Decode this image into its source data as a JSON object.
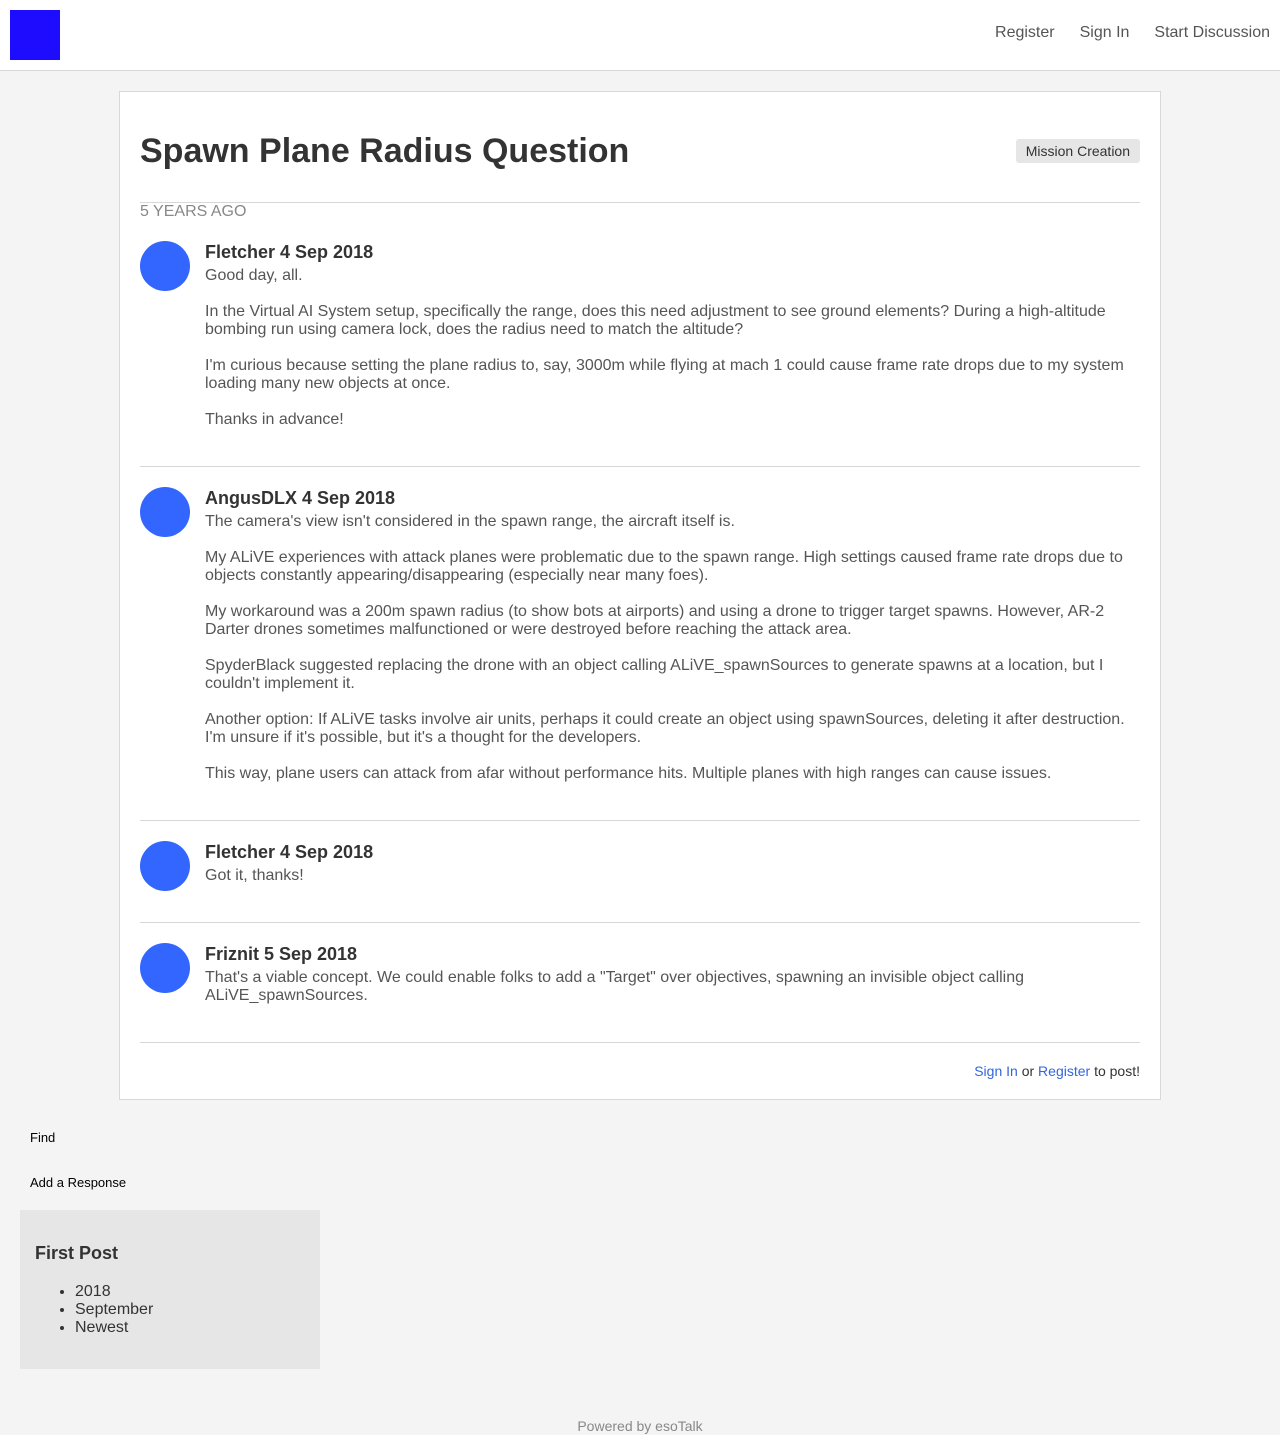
{
  "header": {
    "nav": [
      "Register",
      "Sign In",
      "Start Discussion"
    ],
    "logo_color": "#1e0cff"
  },
  "discussion": {
    "title": "Spawn Plane Radius Question",
    "tag": "Mission Creation",
    "age": "5 YEARS AGO"
  },
  "posts": [
    {
      "heading": "Fletcher 4 Sep 2018",
      "paragraphs": [
        "Good day, all.",
        "In the Virtual AI System setup, specifically the range, does this need adjustment to see ground elements? During a high-altitude bombing run using camera lock, does the radius need to match the altitude?",
        "I'm curious because setting the plane radius to, say, 3000m while flying at mach 1 could cause frame rate drops due to my system loading many new objects at once.",
        "Thanks in advance!"
      ]
    },
    {
      "heading": "AngusDLX 4 Sep 2018",
      "paragraphs": [
        "The camera's view isn't considered in the spawn range, the aircraft itself is.",
        "My ALiVE experiences with attack planes were problematic due to the spawn range. High settings caused frame rate drops due to objects constantly appearing/disappearing (especially near many foes).",
        "My workaround was a 200m spawn radius (to show bots at airports) and using a drone to trigger target spawns. However, AR-2 Darter drones sometimes malfunctioned or were destroyed before reaching the attack area.",
        "SpyderBlack suggested replacing the drone with an object calling ALiVE_spawnSources to generate spawns at a location, but I couldn't implement it.",
        "Another option: If ALiVE tasks involve air units, perhaps it could create an object using spawnSources, deleting it after destruction. I'm unsure if it's possible, but it's a thought for the developers.",
        "This way, plane users can attack from afar without performance hits. Multiple planes with high ranges can cause issues."
      ]
    },
    {
      "heading": "Fletcher 4 Sep 2018",
      "paragraphs": [
        "Got it, thanks!"
      ]
    },
    {
      "heading": "Friznit 5 Sep 2018",
      "paragraphs": [
        "That's a viable concept. We could enable folks to add a \"Target\" over objectives, spawning an invisible object calling ALiVE_spawnSources."
      ]
    }
  ],
  "post_prompt": {
    "sign_in": "Sign In",
    "or": " or ",
    "register": "Register",
    "suffix": " to post!"
  },
  "sidebar": {
    "find": "Find",
    "add_response": "Add a Response",
    "first_post": {
      "title": "First Post",
      "items": [
        "2018",
        "September",
        "Newest"
      ]
    }
  },
  "footer": "Powered by esoTalk",
  "colors": {
    "avatar": "#3366ff",
    "link": "#3366dd"
  }
}
